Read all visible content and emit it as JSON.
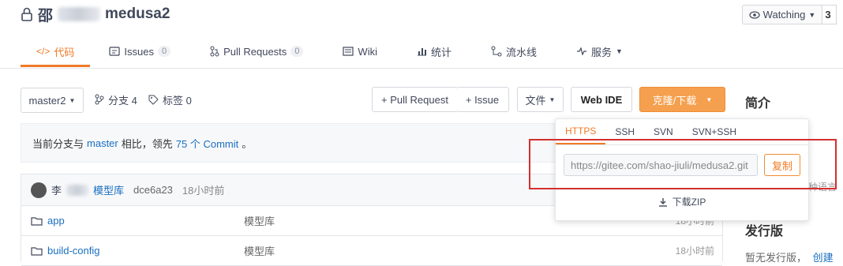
{
  "header": {
    "owner_prefix": "邵",
    "repo_name": "medusa2",
    "watch_label": "Watching",
    "watch_count": "3"
  },
  "tabs": [
    {
      "label": "代码",
      "badge": null,
      "icon": "code-icon",
      "active": true
    },
    {
      "label": "Issues",
      "badge": "0",
      "icon": "issues-icon"
    },
    {
      "label": "Pull Requests",
      "badge": "0",
      "icon": "pull-request-icon"
    },
    {
      "label": "Wiki",
      "badge": null,
      "icon": "wiki-icon"
    },
    {
      "label": "统计",
      "badge": null,
      "icon": "stats-icon"
    },
    {
      "label": "流水线",
      "badge": null,
      "icon": "pipeline-icon"
    },
    {
      "label": "服务",
      "badge": null,
      "icon": "service-icon"
    }
  ],
  "toolbar": {
    "branch": "master2",
    "branches": "分支 4",
    "tags": "标签 0",
    "pull_request": "+ Pull Request",
    "issue": "+ Issue",
    "file": "文件",
    "web_ide": "Web IDE",
    "clone": "克隆/下载"
  },
  "sidebar": {
    "intro": "简介",
    "lang_snippet": "种语言",
    "release_title": "发行版",
    "release_text": "暂无发行版，",
    "release_link": "创建"
  },
  "ahead": {
    "prefix": "当前分支与",
    "branch_link": "master",
    "middle": "相比，领先",
    "count_link": "75 个 Commit",
    "suffix": "。"
  },
  "commit": {
    "author": "李",
    "message": "模型库",
    "hash": "dce6a23",
    "time": "18小时前"
  },
  "files": [
    {
      "name": "app",
      "message": "模型库",
      "time": "18小时前"
    },
    {
      "name": "build-config",
      "message": "模型库",
      "time": "18小时前"
    }
  ],
  "clone_dropdown": {
    "tabs": [
      "HTTPS",
      "SSH",
      "SVN",
      "SVN+SSH"
    ],
    "url": "https://gitee.com/shao-jiuli/medusa2.git",
    "copy": "复制",
    "zip": "下载ZIP"
  },
  "colors": {
    "accent": "#f07a27",
    "link": "#1a6fbf",
    "highlight": "#d32f2f"
  }
}
